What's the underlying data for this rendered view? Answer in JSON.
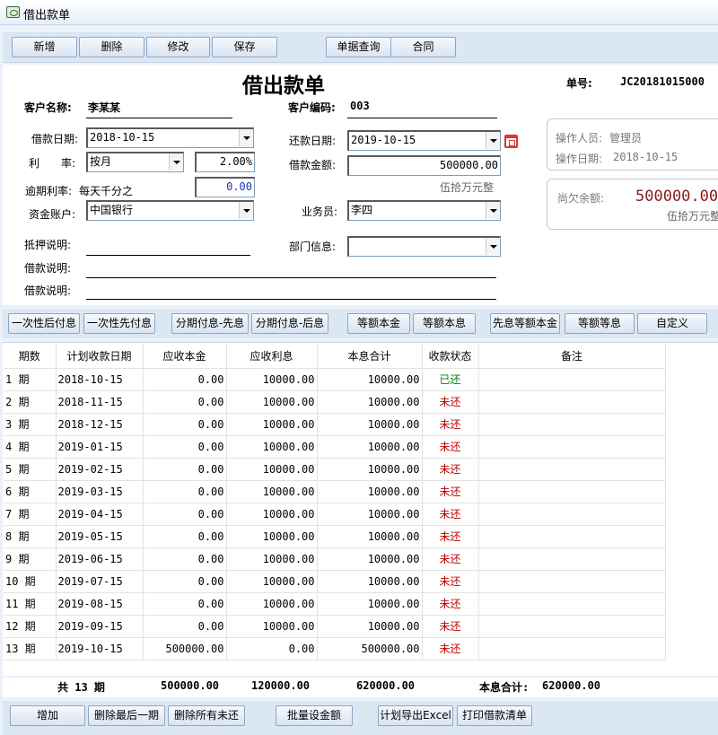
{
  "window": {
    "title": "借出款单"
  },
  "toolbar": {
    "add": "新增",
    "delete": "删除",
    "edit": "修改",
    "save": "保存",
    "query": "单据查询",
    "contract": "合同"
  },
  "form": {
    "title": "借出款单",
    "doc_no_label": "单号:",
    "doc_no": "JC20181015000",
    "customer_name_label": "客户名称:",
    "customer_name": "李某某",
    "customer_code_label": "客户编码:",
    "customer_code": "003",
    "loan_date_label": "借款日期:",
    "loan_date": "2018-10-15",
    "repay_date_label": "还款日期:",
    "repay_date": "2019-10-15",
    "rate_label": "利　　率:",
    "rate_period": "按月",
    "rate_value": "2.00%",
    "amount_label": "借款金额:",
    "amount": "500000.00",
    "amount_words": "伍拾万元整",
    "overdue_label": "逾期利率:",
    "overdue_desc": "每天千分之",
    "overdue_value": "0.00",
    "account_label": "资金账户:",
    "account": "中国银行",
    "salesman_label": "业务员:",
    "salesman": "李四",
    "dept_label": "部门信息:",
    "dept": "",
    "collateral_label": "抵押说明:",
    "note1_label": "借款说明:",
    "note2_label": "借款说明:",
    "operator_label": "操作人员:",
    "operator": "管理员",
    "op_date_label": "操作日期:",
    "op_date": "2018-10-15",
    "balance_label": "尚欠余额:",
    "balance": "500000.00",
    "balance_words": "伍拾万元整",
    "accent": "#8b1a1a"
  },
  "plans": {
    "b1": "一次性后付息",
    "b2": "一次性先付息",
    "b3": "分期付息-先息",
    "b4": "分期付息-后息",
    "b5": "等额本金",
    "b6": "等额本息",
    "b7": "先息等额本金",
    "b8": "等额等息",
    "b9": "自定义"
  },
  "table": {
    "headers": [
      "期数",
      "计划收款日期",
      "应收本金",
      "应收利息",
      "本息合计",
      "收款状态",
      "备注"
    ],
    "rows": [
      [
        "1 期",
        "2018-10-15",
        "0.00",
        "10000.00",
        "10000.00",
        "已还",
        ""
      ],
      [
        "2 期",
        "2018-11-15",
        "0.00",
        "10000.00",
        "10000.00",
        "未还",
        ""
      ],
      [
        "3 期",
        "2018-12-15",
        "0.00",
        "10000.00",
        "10000.00",
        "未还",
        ""
      ],
      [
        "4 期",
        "2019-01-15",
        "0.00",
        "10000.00",
        "10000.00",
        "未还",
        ""
      ],
      [
        "5 期",
        "2019-02-15",
        "0.00",
        "10000.00",
        "10000.00",
        "未还",
        ""
      ],
      [
        "6 期",
        "2019-03-15",
        "0.00",
        "10000.00",
        "10000.00",
        "未还",
        ""
      ],
      [
        "7 期",
        "2019-04-15",
        "0.00",
        "10000.00",
        "10000.00",
        "未还",
        ""
      ],
      [
        "8 期",
        "2019-05-15",
        "0.00",
        "10000.00",
        "10000.00",
        "未还",
        ""
      ],
      [
        "9 期",
        "2019-06-15",
        "0.00",
        "10000.00",
        "10000.00",
        "未还",
        ""
      ],
      [
        "10 期",
        "2019-07-15",
        "0.00",
        "10000.00",
        "10000.00",
        "未还",
        ""
      ],
      [
        "11 期",
        "2019-08-15",
        "0.00",
        "10000.00",
        "10000.00",
        "未还",
        ""
      ],
      [
        "12 期",
        "2019-09-15",
        "0.00",
        "10000.00",
        "10000.00",
        "未还",
        ""
      ],
      [
        "13 期",
        "2019-10-15",
        "500000.00",
        "0.00",
        "500000.00",
        "未还",
        ""
      ]
    ],
    "paid_status": "已还",
    "paid_color": "#008000",
    "unpaid_color": "#c00000"
  },
  "footer": {
    "count": "共 13 期",
    "principal": "500000.00",
    "interest": "120000.00",
    "total": "620000.00",
    "grand_label": "本息合计:",
    "grand": "620000.00"
  },
  "actions": {
    "add": "增加",
    "del_last": "删除最后一期",
    "del_unpaid": "删除所有未还",
    "batch": "批量设金额",
    "export": "计划导出Excel",
    "print": "打印借款清单"
  }
}
